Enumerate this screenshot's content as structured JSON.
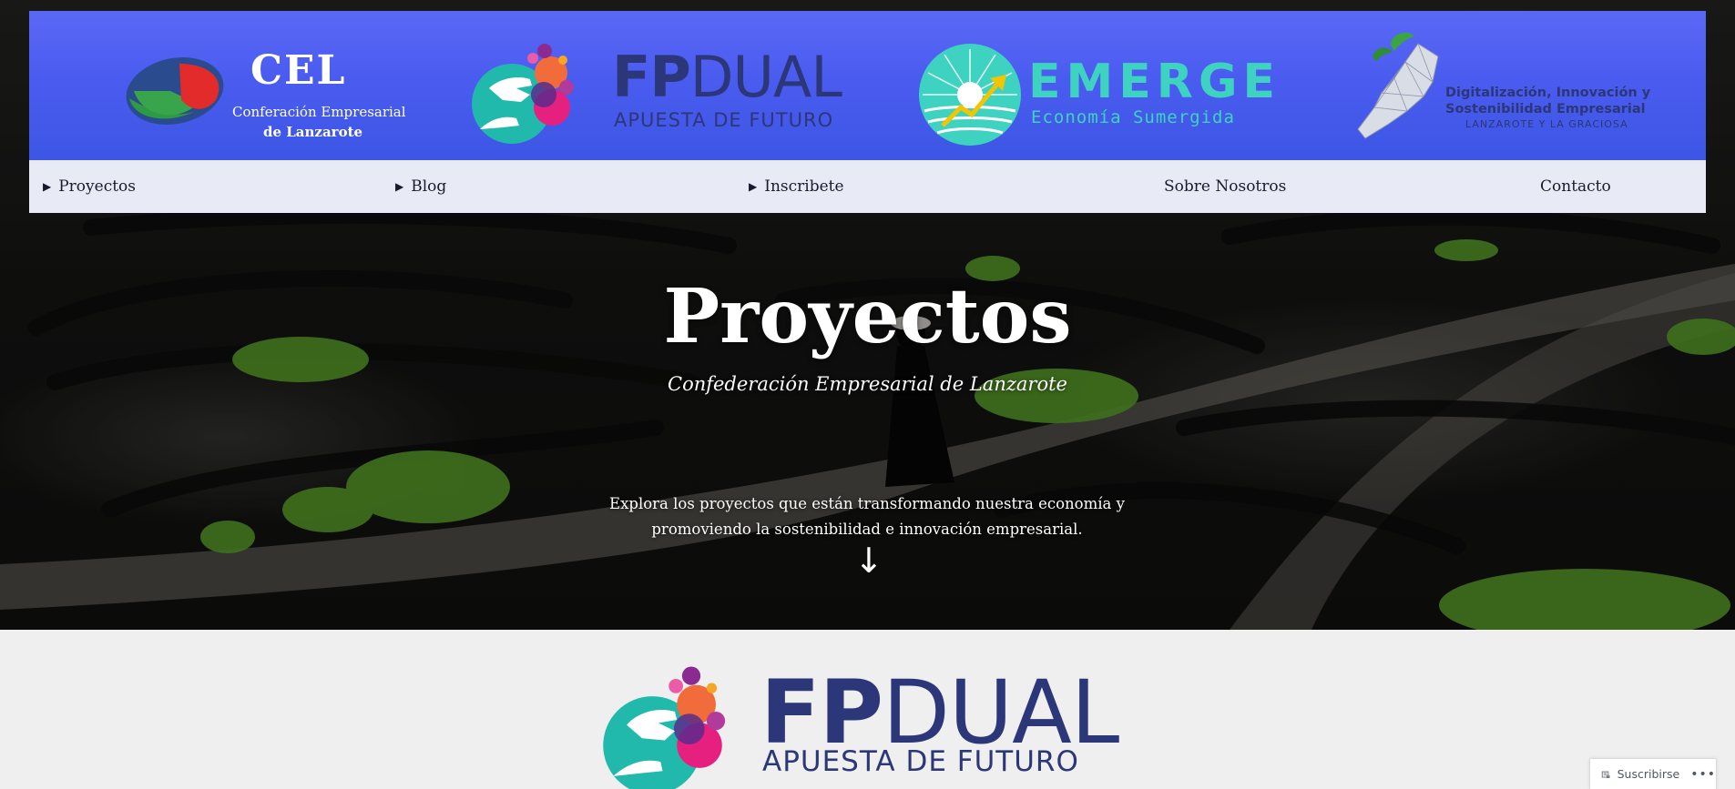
{
  "header_logos": {
    "cel": {
      "title": "CEL",
      "line1": "Conferación Empresarial",
      "line2": "de Lanzarote"
    },
    "fpdual": {
      "word_bold": "FP",
      "word_light": "DUAL",
      "tagline": "APUESTA DE FUTURO"
    },
    "emerge": {
      "word": "EMERGE",
      "tagline": "Economía Sumergida"
    },
    "digital": {
      "line1": "Digitalización, Innovación y",
      "line2": "Sostenibilidad Empresarial",
      "line3": "LANZAROTE Y LA GRACIOSA"
    }
  },
  "nav": {
    "items": [
      {
        "label": "Proyectos",
        "has_submenu": true
      },
      {
        "label": "Blog",
        "has_submenu": true
      },
      {
        "label": "Inscribete",
        "has_submenu": true
      },
      {
        "label": "Sobre Nosotros",
        "has_submenu": false
      },
      {
        "label": "Contacto",
        "has_submenu": false
      }
    ]
  },
  "hero": {
    "title": "Proyectos",
    "subtitle": "Confederación Empresarial de Lanzarote",
    "description": "Explora los proyectos que están transformando nuestra economía y promoviendo la sostenibilidad e innovación empresarial.",
    "arrow": "↓"
  },
  "content": {
    "fpdual": {
      "word_bold": "FP",
      "word_light": "DUAL",
      "tagline": "APUESTA DE FUTURO"
    }
  },
  "subscribe": {
    "label": "Suscribirse",
    "more": "•••"
  },
  "colors": {
    "brand_band": "#4a5cf0",
    "nav_bg": "#e8eaf5",
    "navy": "#2b3778",
    "teal": "#3ed3c0"
  }
}
